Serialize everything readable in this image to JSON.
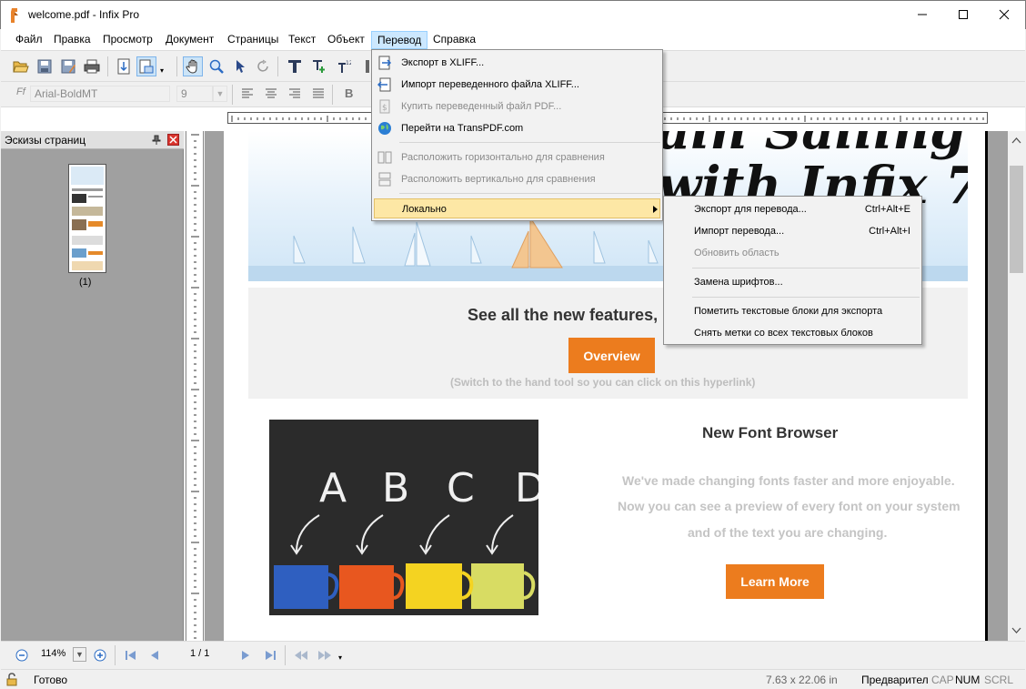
{
  "window": {
    "title": "welcome.pdf - Infix Pro"
  },
  "menubar": {
    "items": [
      "Файл",
      "Правка",
      "Просмотр",
      "Документ",
      "Страницы",
      "Текст",
      "Объект",
      "Перевод",
      "Справка"
    ],
    "open_item": "Перевод"
  },
  "toolbar": {
    "font_name": "Arial-BoldMT",
    "font_size": "9",
    "bold_label": "B"
  },
  "panel": {
    "title": "Эскизы страниц",
    "thumb_label": "(1)"
  },
  "document": {
    "headline_script": "ain Sailing\nwith Infix 7",
    "features_heading": "See all the new features,",
    "overview_button": "Overview",
    "hint": "(Switch to the hand tool so you can click on this hyperlink)",
    "letters": [
      "A",
      "B",
      "C",
      "D"
    ],
    "font_browser_title": "New Font Browser",
    "font_browser_lines": [
      "We've made changing fonts faster and more enjoyable.",
      "Now you can see a preview of every font on your system",
      "and of the text you are changing."
    ],
    "learn_more_button": "Learn More"
  },
  "translation_menu": {
    "items": [
      {
        "label": "Экспорт в XLIFF...",
        "icon": "export-xliff-icon",
        "disabled": false
      },
      {
        "label": "Импорт переведенного файла XLIFF...",
        "icon": "import-xliff-icon",
        "disabled": false
      },
      {
        "label": "Купить переведенный файл PDF...",
        "icon": "buy-pdf-icon",
        "disabled": true
      },
      {
        "label": "Перейти на TransPDF.com",
        "icon": "globe-icon",
        "disabled": false
      },
      {
        "label": "Расположить горизонтально для сравнения",
        "icon": "tile-horizontal-icon",
        "disabled": true
      },
      {
        "label": "Расположить вертикально для сравнения",
        "icon": "tile-vertical-icon",
        "disabled": true
      },
      {
        "label": "Локально",
        "icon": "",
        "disabled": false,
        "highlighted": true
      }
    ]
  },
  "local_submenu": {
    "items": [
      {
        "label": "Экспорт для перевода...",
        "shortcut": "Ctrl+Alt+E",
        "disabled": false
      },
      {
        "label": "Импорт перевода...",
        "shortcut": "Ctrl+Alt+I",
        "disabled": false
      },
      {
        "label": "Обновить область",
        "shortcut": "",
        "disabled": true
      },
      {
        "label": "Замена шрифтов...",
        "shortcut": "",
        "disabled": false
      },
      {
        "label": "Пометить текстовые блоки для экспорта",
        "shortcut": "",
        "disabled": false
      },
      {
        "label": "Снять метки со всех текстовых блоков",
        "shortcut": "",
        "disabled": false
      }
    ]
  },
  "navbar": {
    "zoom": "114%",
    "page": "1 / 1"
  },
  "statusbar": {
    "status": "Готово",
    "coords": "7.63 x 22.06 in",
    "mode": "Предварител",
    "cap": "CAP",
    "num": "NUM",
    "scrl": "SCRL"
  },
  "colors": {
    "accent_orange": "#ec7c1e",
    "menu_highlight": "#fde7a5",
    "menubar_open": "#cce8ff"
  }
}
